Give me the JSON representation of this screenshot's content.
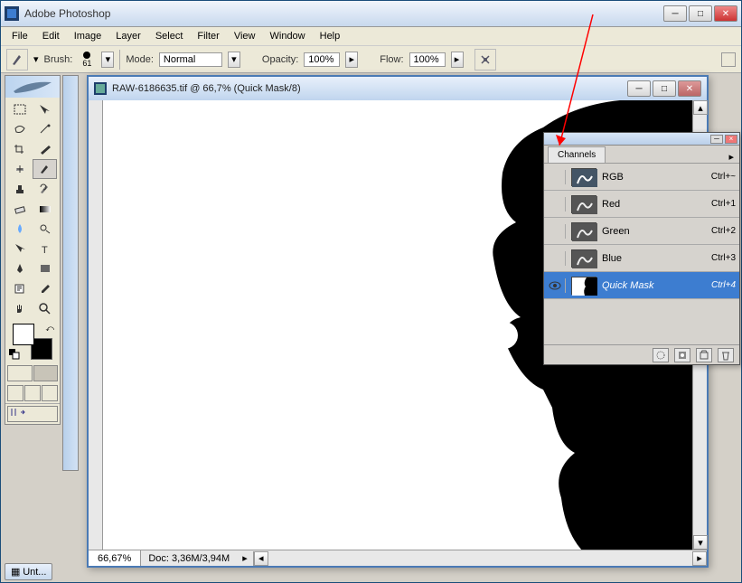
{
  "app": {
    "title": "Adobe Photoshop"
  },
  "menu": [
    "File",
    "Edit",
    "Image",
    "Layer",
    "Select",
    "Filter",
    "View",
    "Window",
    "Help"
  ],
  "options": {
    "brush_label": "Brush:",
    "brush_size": "61",
    "mode_label": "Mode:",
    "mode_value": "Normal",
    "opacity_label": "Opacity:",
    "opacity_value": "100%",
    "flow_label": "Flow:",
    "flow_value": "100%"
  },
  "document": {
    "title": "RAW-6186635.tif @ 66,7% (Quick Mask/8)",
    "zoom": "66,67%",
    "doc_info": "Doc: 3,36M/3,94M"
  },
  "channels": {
    "tab": "Channels",
    "rows": [
      {
        "name": "RGB",
        "shortcut": "Ctrl+~",
        "thumb": "img"
      },
      {
        "name": "Red",
        "shortcut": "Ctrl+1",
        "thumb": "img"
      },
      {
        "name": "Green",
        "shortcut": "Ctrl+2",
        "thumb": "img"
      },
      {
        "name": "Blue",
        "shortcut": "Ctrl+3",
        "thumb": "img"
      },
      {
        "name": "Quick Mask",
        "shortcut": "Ctrl+4",
        "thumb": "mask",
        "selected": true,
        "eye": true
      }
    ]
  },
  "taskbar": {
    "item": "Unt..."
  },
  "colors": {
    "accent": "#3d7dd0",
    "arrow": "#ff0000"
  }
}
